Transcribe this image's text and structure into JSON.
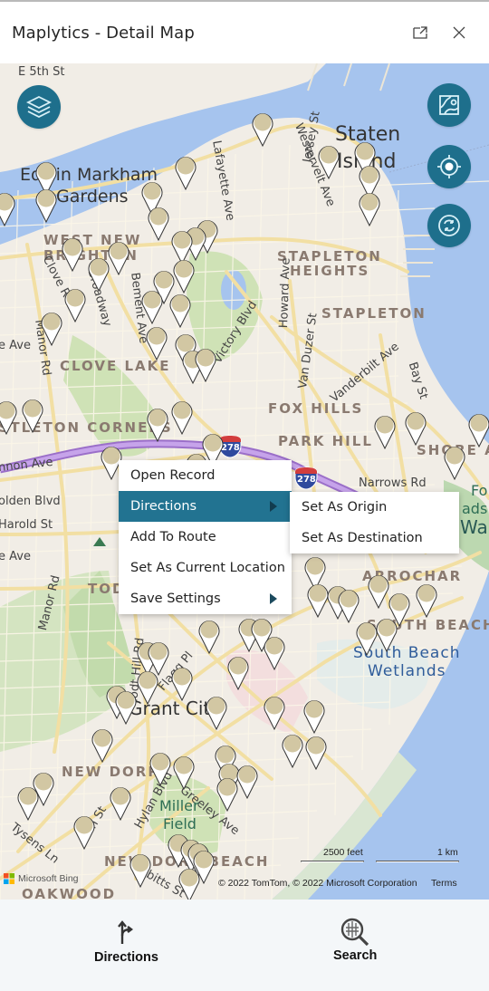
{
  "window": {
    "title": "Maplytics - Detail Map",
    "popout_icon": "popout-icon",
    "close_icon": "close-icon"
  },
  "map": {
    "labels": {
      "cities": [
        "Edwin Markham Gardens",
        "Staten Island",
        "Grant City"
      ],
      "edwin_1": "Edwin Markham",
      "edwin_2": "Gardens",
      "staten_1": "Staten",
      "staten_2": "Island",
      "grant_city": "Grant City",
      "neighborhoods": {
        "west_new_brighton_1": "WEST NEW",
        "west_new_brighton_2": "BRIGHTON",
        "stapleton_heights_1": "STAPLETON",
        "stapleton_heights_2": "HEIGHTS",
        "stapleton": "STAPLETON",
        "clove_lake": "CLOVE LAKE",
        "fox_hills": "FOX HILLS",
        "park_hill": "PARK HILL",
        "castleton_corners": "CASTLETON CORNERS",
        "shore_acres": "SHORE ACRES",
        "arrochar": "ARROCHAR",
        "south_beach": "SOUTH BEACH",
        "todt_hill": "TODT HILL",
        "new_dorp": "NEW DORP",
        "new_dorp_beach": "NEW DORP BEACH",
        "oakwood": "OAKWOOD"
      },
      "streets": {
        "e5th": "E 5th St",
        "lafayette": "Lafayette Ave",
        "westervelt": "Westervelt Ave",
        "jersey": "Jersey St",
        "clove_rd": "Clove Rd",
        "broadway": "Broadway",
        "bement": "Bement Ave",
        "victory": "Victory Blvd",
        "howard": "Howard Ave",
        "van_duzer": "Van Duzer St",
        "vanderbilt": "Vanderbilt Ave",
        "bay": "Bay St",
        "manor_rd": "Manor Rd",
        "manor_rd2": "Manor Rd",
        "rice_ave": "e Ave",
        "castleton_ave": "nnon Ave",
        "golden": "olden Blvd",
        "harold": "Harold St",
        "ave_low": "e Ave",
        "narrows": "Narrows Rd",
        "todt_hill_rd": "Todt Hill Rd",
        "flagg": "Flagg Pl",
        "hylan": "Hylan Blvd",
        "greeley": "Greeley Ave",
        "tysens": "Tysens Ln",
        "ebbitts": "Ebbitts St",
        "n_st": "n St"
      },
      "water": {
        "south_beach_wetlands_1": "South Beach",
        "south_beach_wetlands_2": "Wetlands"
      },
      "parks": {
        "miller_field_1": "Miller",
        "miller_field_2": "Field",
        "fort_wads_1": "Fo",
        "fort_wads_2": "ads",
        "fort_wads_3": "Wa"
      },
      "highway_shield": "278"
    },
    "controls": {
      "layers": "layers-icon",
      "map_style": "map-style-icon",
      "locate": "locate-icon",
      "refresh": "refresh-icon"
    },
    "scale": {
      "imperial": "2500 feet",
      "metric": "1 km"
    },
    "attribution": {
      "provider": "Microsoft Bing",
      "copyright": "© 2022 TomTom, © 2022 Microsoft Corporation",
      "terms": "Terms"
    }
  },
  "context_menu": {
    "items": [
      {
        "label": "Open Record",
        "has_submenu": false
      },
      {
        "label": "Directions",
        "has_submenu": true,
        "active": true
      },
      {
        "label": "Add To Route",
        "has_submenu": false
      },
      {
        "label": "Set As Current Location",
        "has_submenu": false
      },
      {
        "label": "Save Settings",
        "has_submenu": true
      }
    ],
    "submenu": {
      "items": [
        {
          "label": "Set As Origin"
        },
        {
          "label": "Set As Destination"
        }
      ]
    }
  },
  "bottom_nav": {
    "directions": "Directions",
    "search": "Search"
  },
  "colors": {
    "accent": "#227391",
    "fab": "#1e6f8c",
    "water": "#a6c4ee",
    "pin_fill": "#d2c7a3",
    "highway": "#b48ad8"
  }
}
